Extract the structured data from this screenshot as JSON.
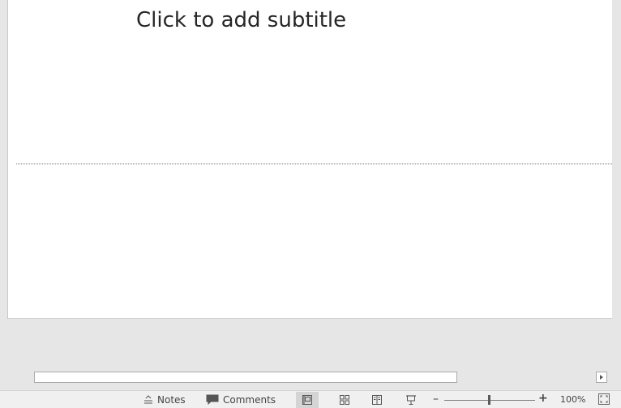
{
  "slide": {
    "subtitle_placeholder": "Click to add subtitle"
  },
  "statusbar": {
    "notes_label": "Notes",
    "comments_label": "Comments",
    "zoom_minus": "–",
    "zoom_plus": "+",
    "zoom_level": "100%",
    "zoom_percent": 100
  },
  "icons": {
    "notes": "notes-icon",
    "comments": "comment-icon",
    "normal_view": "normal-view-icon",
    "slide_sorter": "slide-sorter-icon",
    "reading_view": "reading-view-icon",
    "slide_show": "slide-show-icon",
    "fit_to_window": "fit-to-window-icon"
  }
}
